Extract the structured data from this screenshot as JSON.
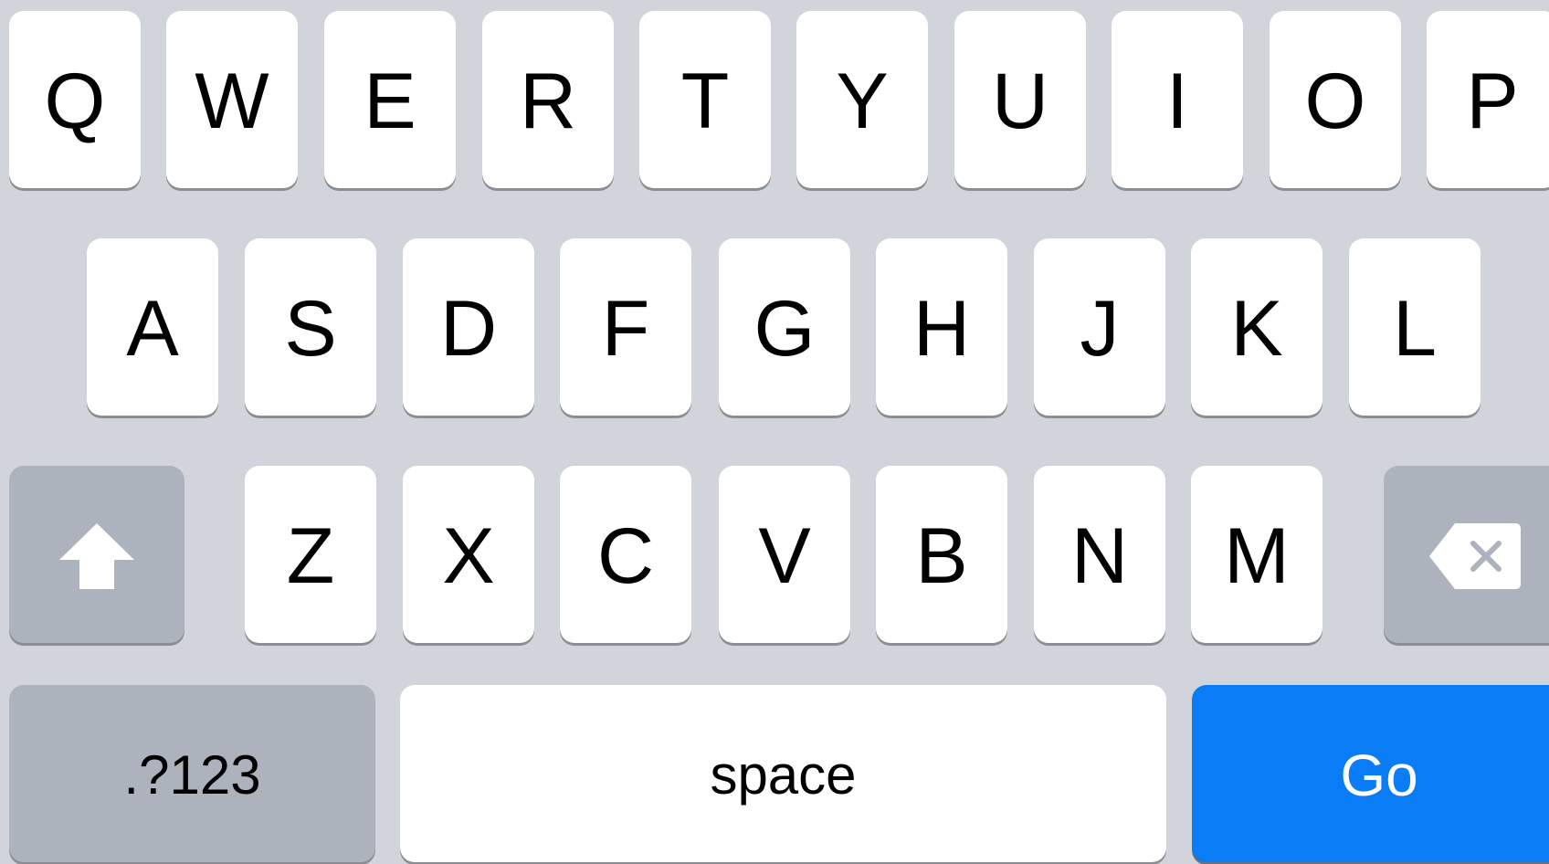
{
  "keyboard": {
    "row1": [
      "Q",
      "W",
      "E",
      "R",
      "T",
      "Y",
      "U",
      "I",
      "O",
      "P"
    ],
    "row2": [
      "A",
      "S",
      "D",
      "F",
      "G",
      "H",
      "J",
      "K",
      "L"
    ],
    "row3": [
      "Z",
      "X",
      "C",
      "V",
      "B",
      "N",
      "M"
    ],
    "shift_icon": "shift-arrow-icon",
    "delete_icon": "delete-backspace-icon",
    "numbers_label": ".?123",
    "space_label": "space",
    "go_label": "Go"
  },
  "colors": {
    "background": "#d1d5db",
    "letter_key": "#ffffff",
    "special_key": "#acb3bd",
    "go_key": "#0a7cf5"
  }
}
